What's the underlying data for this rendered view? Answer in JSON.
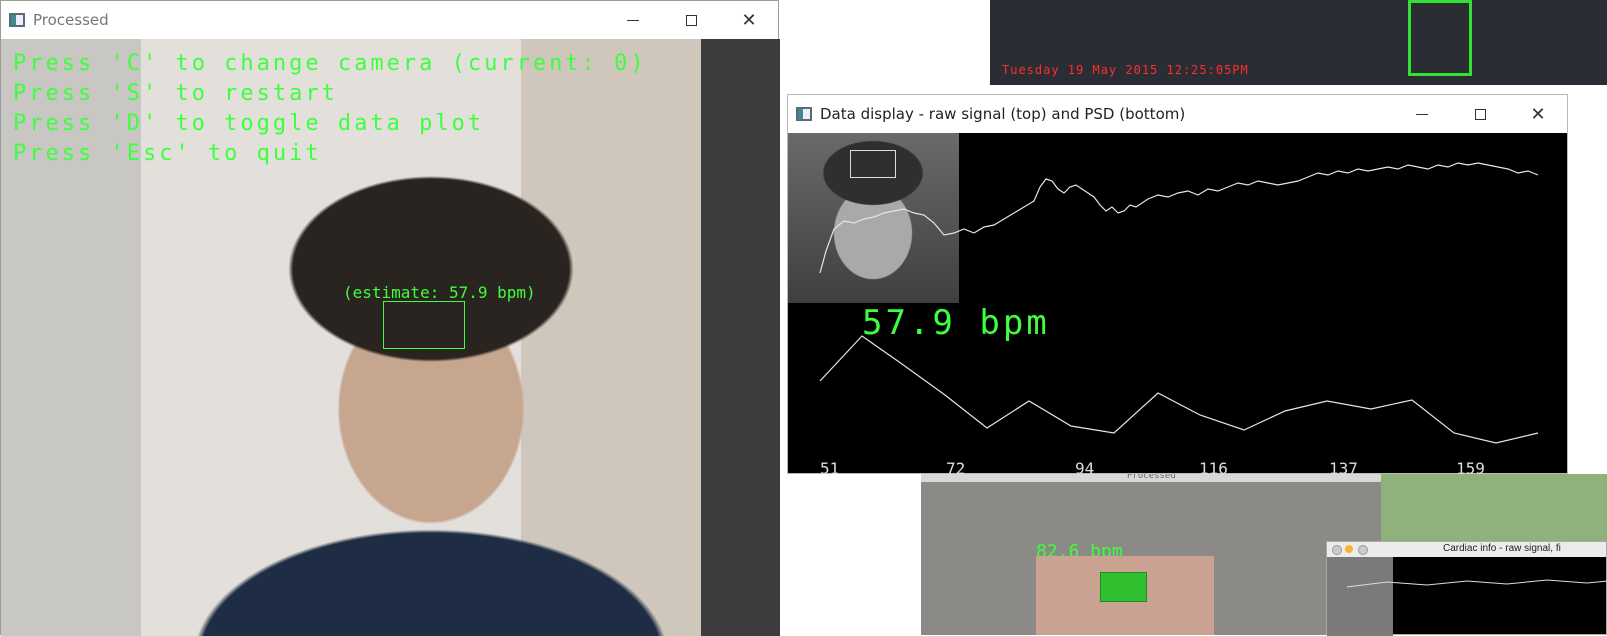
{
  "main_window": {
    "title": "Processed",
    "hud": [
      "Press 'C' to change camera (current: 0)",
      "Press 'S' to restart",
      "Press 'D' to toggle data plot",
      "Press 'Esc' to quit"
    ],
    "estimate": "(estimate: 57.9 bpm)"
  },
  "data_window": {
    "title": "Data display - raw signal (top) and PSD (bottom)",
    "bpm": "57.9 bpm",
    "ticks": [
      "51",
      "72",
      "94",
      "116",
      "137",
      "159"
    ]
  },
  "bg_top": {
    "timestamp": "Tuesday 19 May 2015 12:25:05PM"
  },
  "bg_bottom": {
    "title": "Processed",
    "bpm": "82.6 bpm",
    "cardiac_title": "Cardiac info - raw signal, fi"
  },
  "colors": {
    "hud_green": "#3dff3d",
    "plot_line": "#e6e6e6",
    "timestamp_red": "#ff2d2d"
  }
}
